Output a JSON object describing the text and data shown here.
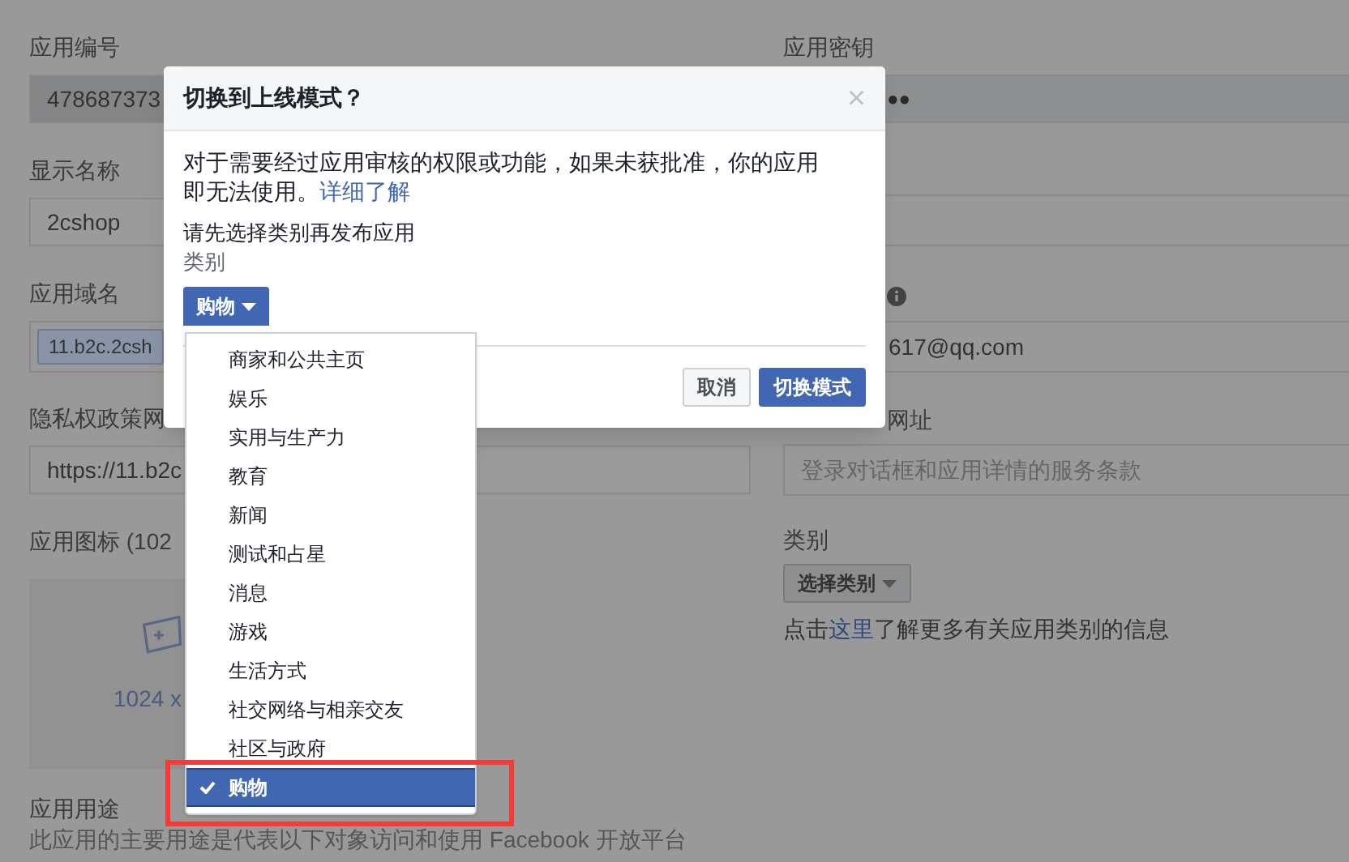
{
  "page": {
    "left": [
      {
        "kind": "field",
        "label": "应用编号",
        "value": "478687373",
        "readonly": true
      },
      {
        "kind": "field",
        "label": "显示名称",
        "value": "2cshop",
        "readonly": false
      },
      {
        "kind": "tag",
        "label": "应用域名",
        "value": "11.b2c.2csh"
      },
      {
        "kind": "field",
        "label": "隐私权政策网",
        "value": "https://11.b2c",
        "readonly": false
      },
      {
        "kind": "image",
        "label": "应用图标 (102",
        "value": "1024 x"
      },
      {
        "kind": "text",
        "label": "应用用途",
        "value": "此应用的主要用途是代表以下对象访问和使用 Facebook 开放平台"
      }
    ],
    "right": [
      {
        "kind": "secret",
        "label": "应用密钥",
        "value": "●●"
      },
      {
        "kind": "blank"
      },
      {
        "kind": "email",
        "value": "617@qq.com"
      },
      {
        "kind": "placeholder",
        "label": "网址",
        "placeholder": "登录对话框和应用详情的服务条款"
      },
      {
        "kind": "category",
        "label": "类别",
        "button": "选择类别",
        "help_before": "点击",
        "help_link": "这里",
        "help_after": "了解更多有关应用类别的信息"
      }
    ]
  },
  "dialog": {
    "title": "切换到上线模式？",
    "close": "×",
    "body": "对于需要经过应用审核的权限或功能，如果未获批准，你的应用即无法使用。",
    "link": "详细了解",
    "prompt": "请先选择类别再发布应用",
    "category_label": "类别",
    "category_button": "购物",
    "buttons": [
      {
        "label": "取消",
        "primary": false
      },
      {
        "label": "切换模式",
        "primary": true
      }
    ]
  },
  "dropdown": {
    "items": [
      {
        "label": "商家和公共主页",
        "selected": false
      },
      {
        "label": "娱乐",
        "selected": false
      },
      {
        "label": "实用与生产力",
        "selected": false
      },
      {
        "label": "教育",
        "selected": false
      },
      {
        "label": "新闻",
        "selected": false
      },
      {
        "label": "测试和占星",
        "selected": false
      },
      {
        "label": "消息",
        "selected": false
      },
      {
        "label": "游戏",
        "selected": false
      },
      {
        "label": "生活方式",
        "selected": false
      },
      {
        "label": "社交网络与相亲交友",
        "selected": false
      },
      {
        "label": "社区与政府",
        "selected": false
      },
      {
        "label": "购物",
        "selected": true
      }
    ]
  }
}
